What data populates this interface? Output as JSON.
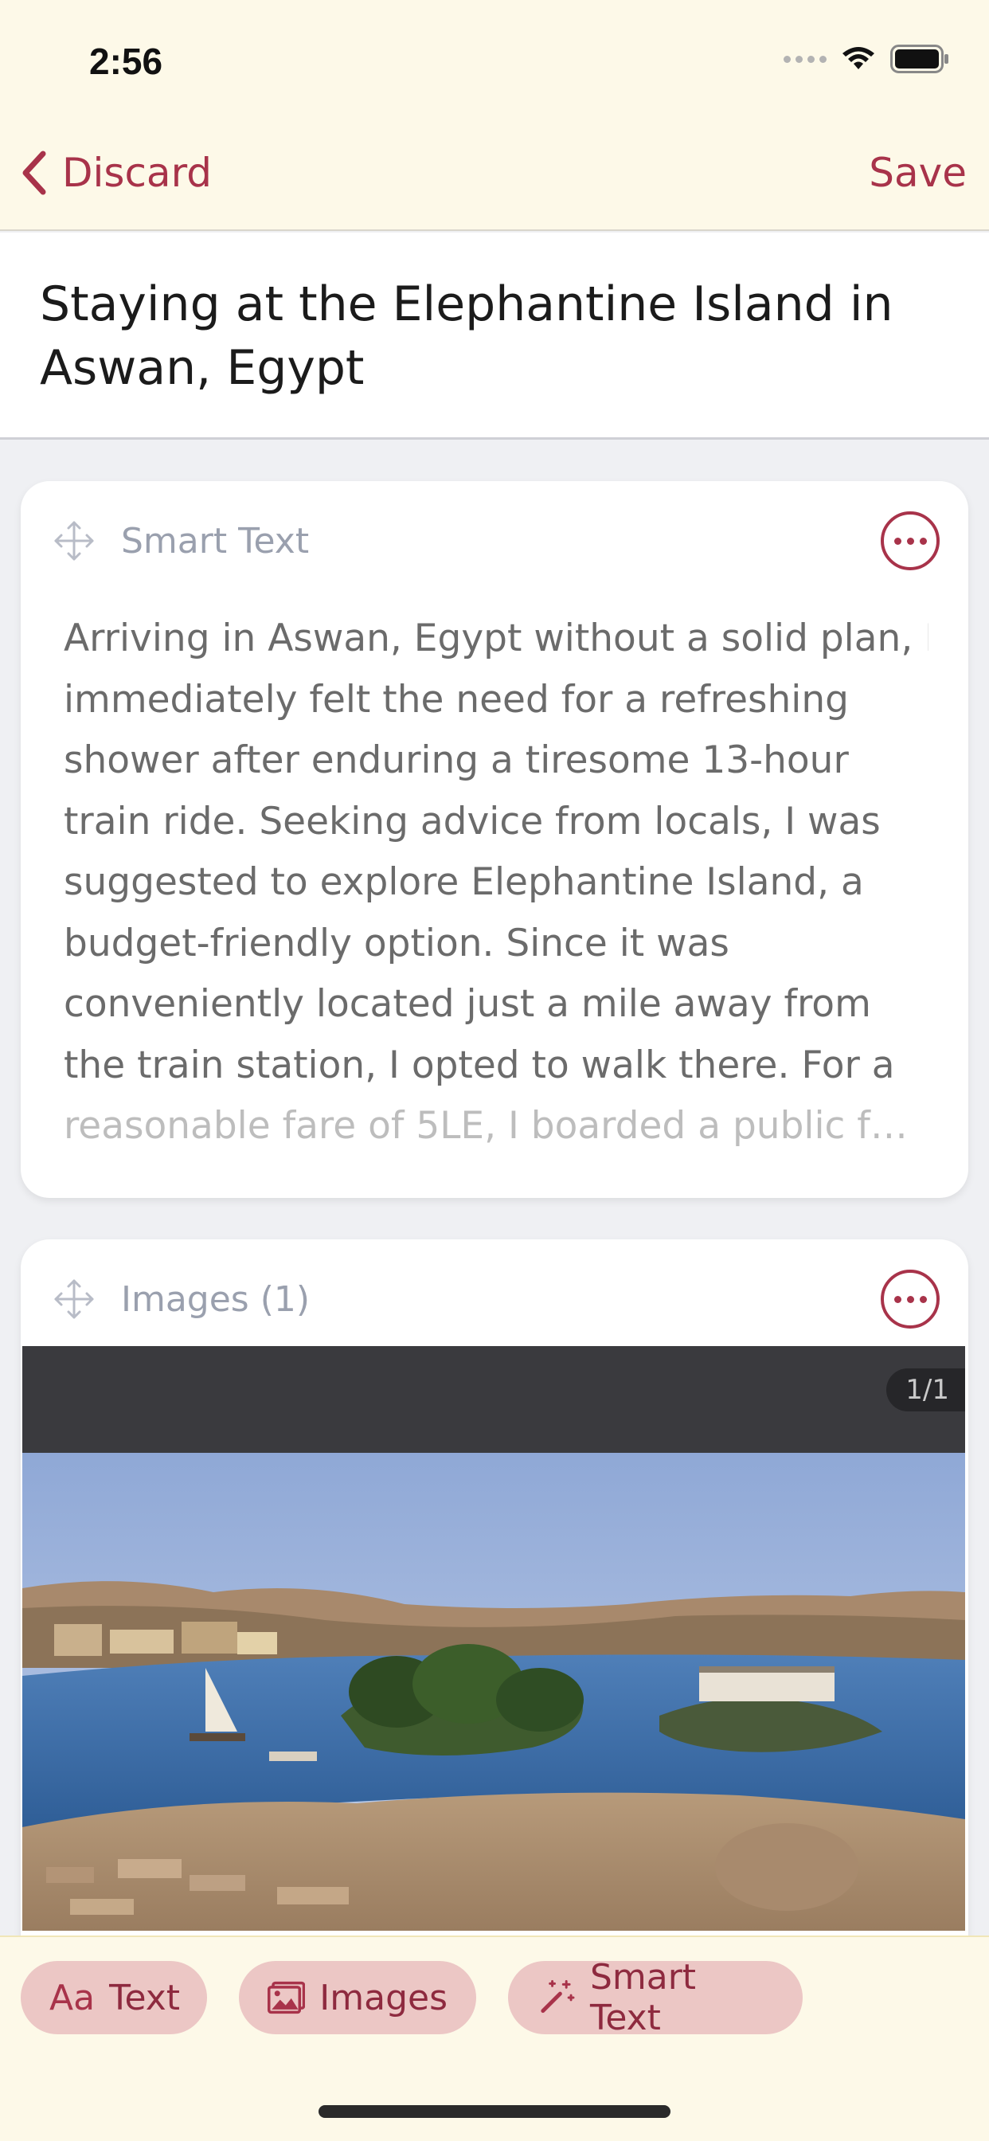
{
  "status_bar": {
    "time": "2:56"
  },
  "nav": {
    "back_label": "Discard",
    "save_label": "Save"
  },
  "post": {
    "title": "Staying at the Elephantine Island in Aswan, Egypt"
  },
  "blocks": [
    {
      "type_label": "Smart Text",
      "lines": [
        "Arriving in Aswan, Egypt without a solid plan, I",
        "immediately felt the need for a refreshing",
        "shower after enduring a tiresome 13-hour",
        "train ride. Seeking advice from locals, I was",
        "suggested to explore Elephantine Island, a",
        "budget-friendly option. Since it was",
        "conveniently located just a mile away from",
        "the train station, I opted to walk there. For a",
        "reasonable fare of 5LE, I boarded a public fe..."
      ]
    },
    {
      "type_label": "Images (1)",
      "counter": "1/1"
    }
  ],
  "toolbar": {
    "text_label": "Text",
    "text_glyph": "Aa",
    "images_label": "Images",
    "smart_label": "Smart Text"
  },
  "colors": {
    "accent": "#a8334a",
    "chip_bg": "#ecc7c5",
    "header_bg": "#fdf9e8"
  }
}
